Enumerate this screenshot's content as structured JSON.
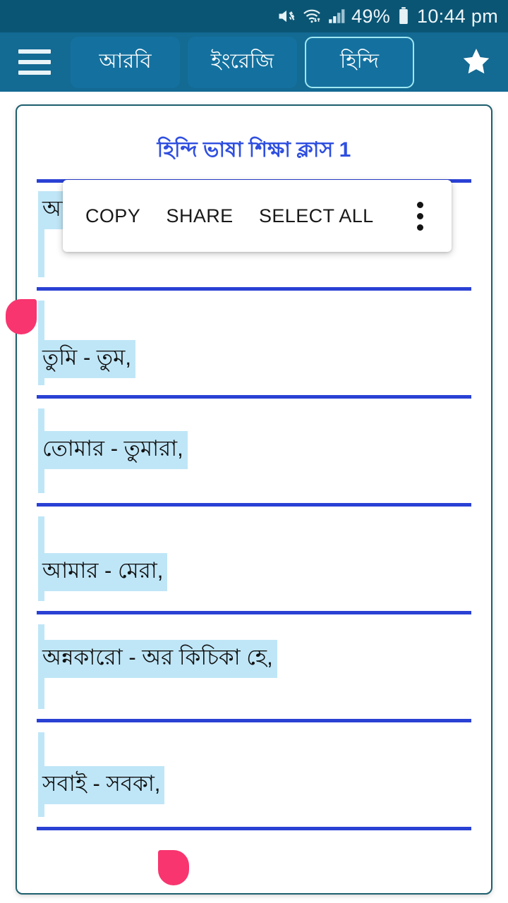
{
  "status_bar": {
    "battery_percent": "49%",
    "time": "10:44 pm",
    "icons": [
      "mute-icon",
      "wifi-icon",
      "signal-icon",
      "battery-icon"
    ]
  },
  "toolbar": {
    "menu_icon": "hamburger-menu-icon",
    "favorite_icon": "star-icon",
    "tabs": [
      {
        "label": "আরবি",
        "selected": false
      },
      {
        "label": "ইংরেজি",
        "selected": false
      },
      {
        "label": "হিন্দি",
        "selected": true
      }
    ]
  },
  "page": {
    "title": "হিন্দি ভাষা শিক্ষা ক্লাস 1"
  },
  "context_menu": {
    "copy_label": "COPY",
    "share_label": "SHARE",
    "select_all_label": "SELECT ALL",
    "overflow_icon": "more-vertical-icon"
  },
  "lessons": [
    {
      "text": "আপনি - আপ,"
    },
    {
      "text": "তুমি - তুম,"
    },
    {
      "text": "তোমার - তুমারা,"
    },
    {
      "text": "আমার - মেরা,"
    },
    {
      "text": "অন্নকারো - অর কিচিকা হে,"
    },
    {
      "text": "সবাই - সবকা,"
    }
  ],
  "colors": {
    "status_bar_bg": "#0b5574",
    "toolbar_bg": "#136a93",
    "tab_bg": "#14719f",
    "tab_selected_border": "#9fe8f2",
    "title_blue": "#2f4fe0",
    "divider_blue": "#2a41d4",
    "selection_highlight": "#bfe6f7",
    "selection_handle": "#f8356f",
    "card_border": "#1d5f6e"
  }
}
